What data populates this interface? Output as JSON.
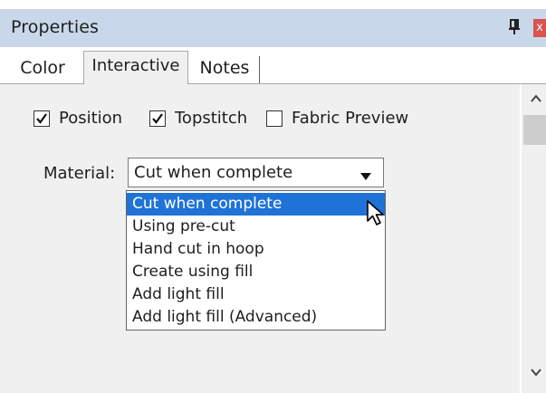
{
  "panel": {
    "title": "Properties",
    "pin_icon": "pin-icon",
    "close_icon": "close-icon",
    "close_label": "x"
  },
  "tabs": [
    {
      "label": "Color",
      "active": false
    },
    {
      "label": "Interactive",
      "active": true
    },
    {
      "label": "Notes",
      "active": false
    }
  ],
  "checkboxes": [
    {
      "label": "Position",
      "checked": true
    },
    {
      "label": "Topstitch",
      "checked": true
    },
    {
      "label": "Fabric Preview",
      "checked": false
    }
  ],
  "material": {
    "label": "Material:",
    "value": "Cut when complete",
    "options": [
      "Cut when complete",
      "Using pre-cut",
      "Hand cut in hoop",
      "Create using fill",
      "Add light fill",
      "Add light fill (Advanced)"
    ],
    "highlighted_index": 0
  },
  "colors": {
    "title_bar": "#c9d7ea",
    "selection": "#1f73d6",
    "panel_bg": "#f0f0f0"
  }
}
